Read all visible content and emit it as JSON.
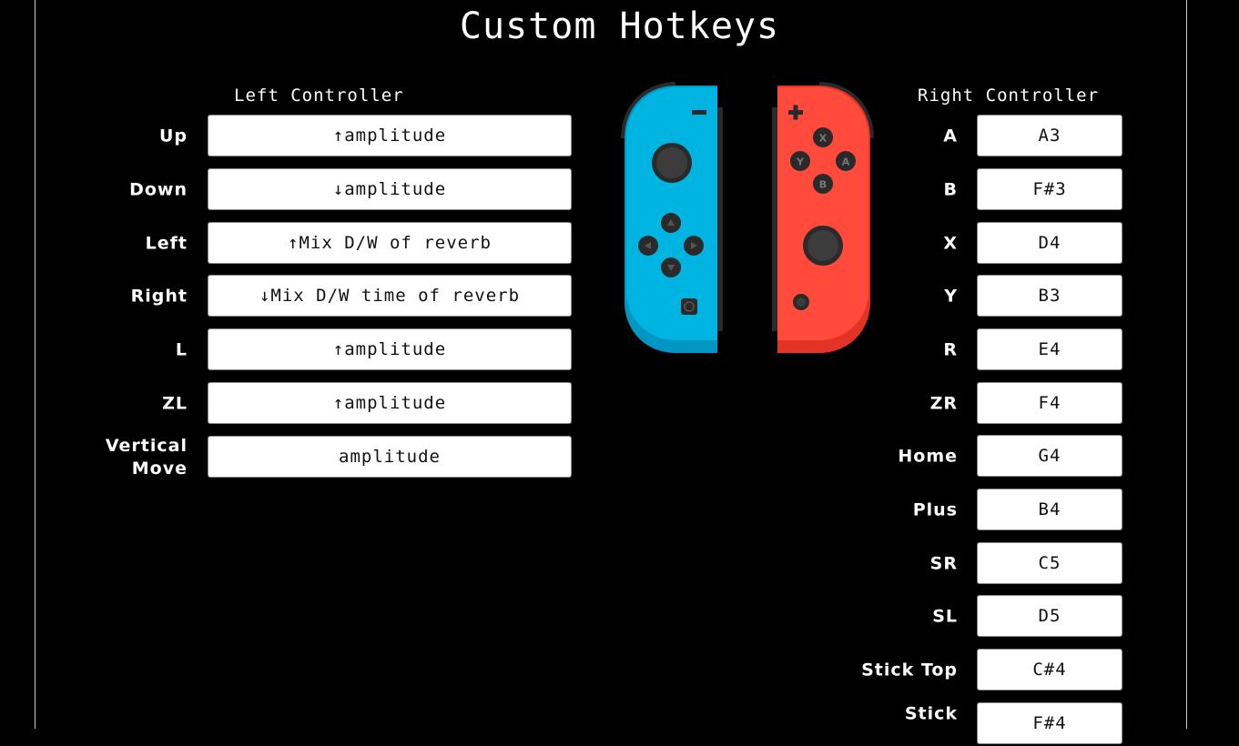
{
  "page": {
    "title": "Custom Hotkeys"
  },
  "left": {
    "title": "Left Controller",
    "rows": [
      {
        "label": "Up",
        "value": "↑amplitude"
      },
      {
        "label": "Down",
        "value": "↓amplitude"
      },
      {
        "label": "Left",
        "value": "↑Mix D/W of reverb"
      },
      {
        "label": "Right",
        "value": "↓Mix D/W time of reverb"
      },
      {
        "label": "L",
        "value": "↑amplitude"
      },
      {
        "label": "ZL",
        "value": "↑amplitude"
      },
      {
        "label": "Vertical Move",
        "value": "amplitude"
      }
    ]
  },
  "right": {
    "title": "Right Controller",
    "rows": [
      {
        "label": "A",
        "value": "A3"
      },
      {
        "label": "B",
        "value": "F#3"
      },
      {
        "label": "X",
        "value": "D4"
      },
      {
        "label": "Y",
        "value": "B3"
      },
      {
        "label": "R",
        "value": "E4"
      },
      {
        "label": "ZR",
        "value": "F4"
      },
      {
        "label": "Home",
        "value": "G4"
      },
      {
        "label": "Plus",
        "value": "B4"
      },
      {
        "label": "SR",
        "value": "C5"
      },
      {
        "label": "SL",
        "value": "D5"
      },
      {
        "label": "Stick Top",
        "value": "C#4"
      },
      {
        "label": "Stick",
        "value": "F#4"
      }
    ]
  },
  "joycon": {
    "face_buttons": {
      "x": "X",
      "y": "Y",
      "a": "A",
      "b": "B"
    },
    "colors": {
      "left_body": "#00B4E2",
      "left_shade": "#0096C4",
      "right_body": "#FF4A3C",
      "right_shade": "#E33327",
      "button": "#3a3a3a"
    }
  }
}
